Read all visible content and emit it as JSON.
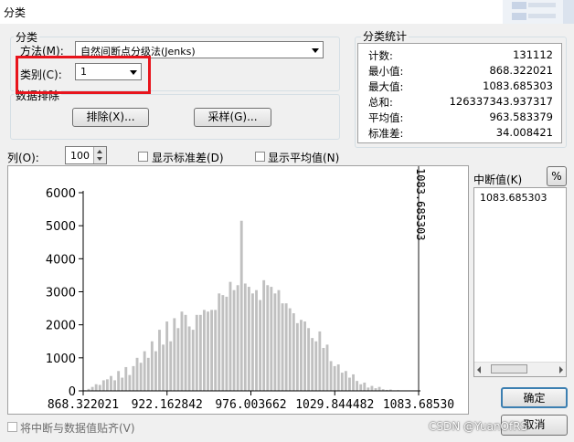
{
  "window": {
    "title": "分类"
  },
  "classification_group": {
    "label": "分类",
    "method_label": "方法(M):",
    "method_value": "自然间断点分级法(Jenks)",
    "classes_label": "类别(C):",
    "classes_value": "1"
  },
  "exclusion_group": {
    "label": "数据排除",
    "exclude_button": "排除(X)...",
    "sampling_button": "采样(G)..."
  },
  "stats_group": {
    "label": "分类统计",
    "rows": [
      {
        "key": "计数:",
        "value": "131112"
      },
      {
        "key": "最小值:",
        "value": "868.322021"
      },
      {
        "key": "最大值:",
        "value": "1083.685303"
      },
      {
        "key": "总和:",
        "value": "126337343.937317"
      },
      {
        "key": "平均值:",
        "value": "963.583379"
      },
      {
        "key": "标准差:",
        "value": "34.008421"
      }
    ]
  },
  "options": {
    "columns_label": "列(O):",
    "columns_value": "100",
    "show_std_label": "显示标准差(D)",
    "show_mean_label": "显示平均值(N)",
    "snap_label": "将中断与数据值贴齐(V)"
  },
  "breaks": {
    "label": "中断值(K)",
    "percent_button": "%",
    "values": [
      "1083.685303"
    ]
  },
  "buttons": {
    "ok": "确定",
    "cancel": "取消"
  },
  "watermark": "CSDN @YuanOfRS",
  "chart_data": {
    "type": "bar",
    "y_ticks": [
      "6000",
      "5000",
      "4000",
      "3000",
      "2000",
      "1000",
      "0"
    ],
    "ylim": [
      0,
      6000
    ],
    "x_ticks": [
      "868.322021",
      "922.162842",
      "976.003662",
      "1029.844482",
      "1083.68530"
    ],
    "xlim": [
      868.322021,
      1083.685303
    ],
    "break_label": "1083.685303",
    "break_value": 1083.685303,
    "values": [
      20,
      60,
      120,
      200,
      180,
      320,
      350,
      450,
      320,
      600,
      400,
      720,
      480,
      750,
      1000,
      850,
      1200,
      1000,
      1500,
      1200,
      1850,
      1400,
      2100,
      1500,
      2200,
      1900,
      2400,
      2300,
      1950,
      1850,
      2300,
      2300,
      2450,
      2400,
      2450,
      2450,
      2950,
      2900,
      2850,
      3300,
      3050,
      3200,
      5150,
      3250,
      3150,
      2950,
      3050,
      2750,
      3350,
      3200,
      3150,
      2950,
      3050,
      2650,
      2650,
      2500,
      2350,
      2050,
      2150,
      2100,
      1900,
      1600,
      1500,
      1800,
      1300,
      1400,
      900,
      750,
      800,
      550,
      600,
      400,
      500,
      300,
      200,
      250,
      100,
      150,
      80,
      120,
      50,
      30,
      40,
      15,
      20,
      10,
      5,
      5,
      0,
      0
    ]
  }
}
